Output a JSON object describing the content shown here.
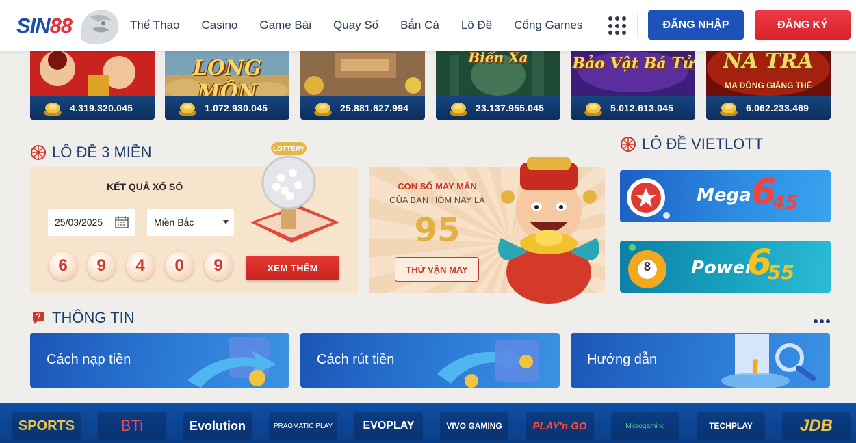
{
  "header": {
    "logo": "SIN88",
    "nav": [
      "Thể Thao",
      "Casino",
      "Game Bài",
      "Quay Số",
      "Bắn Cá",
      "Lô Đề",
      "Cổng Games"
    ],
    "login_label": "ĐĂNG NHẬP",
    "register_label": "ĐĂNG KÝ"
  },
  "games": [
    {
      "title": "",
      "jackpot": "4.319.320.045"
    },
    {
      "title": "LONG MÔN",
      "jackpot": "1.072.930.045"
    },
    {
      "title": "",
      "jackpot": "25.881.627.994"
    },
    {
      "title": "Biển Xa",
      "jackpot": "23.137.955.045"
    },
    {
      "title": "Bảo Vật Bá Tử",
      "jackpot": "5.012.613.045"
    },
    {
      "title": "NA TRA",
      "subtitle": "MA ĐỒNG GIÁNG THẾ",
      "jackpot": "6.062.233.469"
    }
  ],
  "lode": {
    "heading": "LÔ ĐỀ 3 MIỀN",
    "result_title": "KẾT QUẢ XỔ SỐ",
    "date": "25/03/2025",
    "region": "Miền Bắc",
    "balls": [
      "6",
      "9",
      "4",
      "0",
      "9"
    ],
    "more_label": "XEM THÊM",
    "lotto_tag": "LOTTERY"
  },
  "lucky": {
    "line1": "CON SỐ MAY MẮN",
    "line2": "CỦA BẠN HÔM NAY LÀ",
    "number": "95",
    "try_label": "THỬ VẬN MAY"
  },
  "vietlott": {
    "heading": "LÔ ĐỀ VIETLOTT",
    "mega": {
      "name": "Mega",
      "big": "6",
      "small": "45"
    },
    "power": {
      "name": "Power",
      "big": "6",
      "small": "55",
      "ball": "8"
    }
  },
  "info": {
    "heading": "THÔNG TIN",
    "cards": [
      "Cách nạp tiền",
      "Cách rút tiền",
      "Hướng dẫn"
    ]
  },
  "providers": [
    "SPORTS",
    "BTi",
    "Evolution",
    "PRAGMATIC PLAY",
    "EVOPLAY",
    "VIVO GAMING",
    "PLAY'n GO",
    "Microgaming",
    "TECHPLAY",
    "JDB"
  ],
  "colors": {
    "brand_blue": "#1d52b8",
    "brand_red": "#e8303a",
    "heading": "#1d3b6f",
    "jackpot_bar": "#0d2f5e"
  }
}
